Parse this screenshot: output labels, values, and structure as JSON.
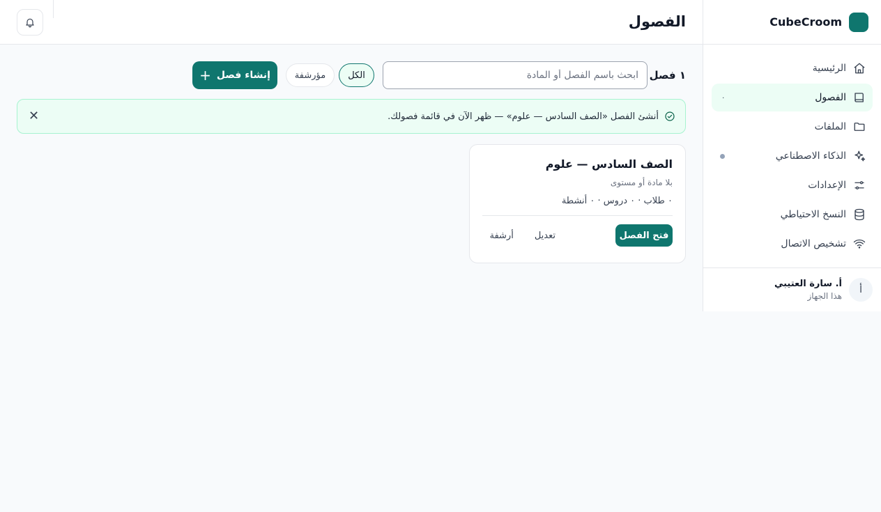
{
  "brand": {
    "name": "CubeCroom"
  },
  "sidebar": {
    "items": [
      {
        "label": "الرئيسية",
        "icon": "home-icon"
      },
      {
        "label": "الفصول",
        "icon": "book-icon",
        "badge": "٠",
        "active": true
      },
      {
        "label": "الملفات",
        "icon": "folder-icon"
      },
      {
        "label": "الذكاء الاصطناعي",
        "icon": "sparkles-icon",
        "dot": true
      },
      {
        "label": "الإعدادات",
        "icon": "sliders-icon"
      },
      {
        "label": "النسخ الاحتياطي",
        "icon": "database-icon"
      },
      {
        "label": "تشخيص الاتصال",
        "icon": "wifi-icon"
      }
    ]
  },
  "profile": {
    "initial": "أ",
    "name": "أ. سارة العتيبي",
    "device": "هذا الجهاز"
  },
  "header": {
    "title": "الفصول"
  },
  "toolbar": {
    "count": "١ فصل",
    "search_placeholder": "ابحث باسم الفصل أو المادة",
    "filter_all": "الكل",
    "filter_archived": "مؤرشفة",
    "create_label": "إنشاء فصل"
  },
  "alert": {
    "message": "أنشئ الفصل «الصف السادس — علوم» — ظهر الآن في قائمة فصولك."
  },
  "card": {
    "title": "الصف السادس — علوم",
    "subject": "بلا مادة أو مستوى",
    "stats": "٠ طلاب · ٠ دروس · ٠ أنشطة",
    "open_label": "فتح الفصل",
    "edit_label": "تعديل",
    "archive_label": "أرشفة"
  },
  "colors": {
    "accent": "#0f766e",
    "alert_bg": "#ecfdf5"
  }
}
